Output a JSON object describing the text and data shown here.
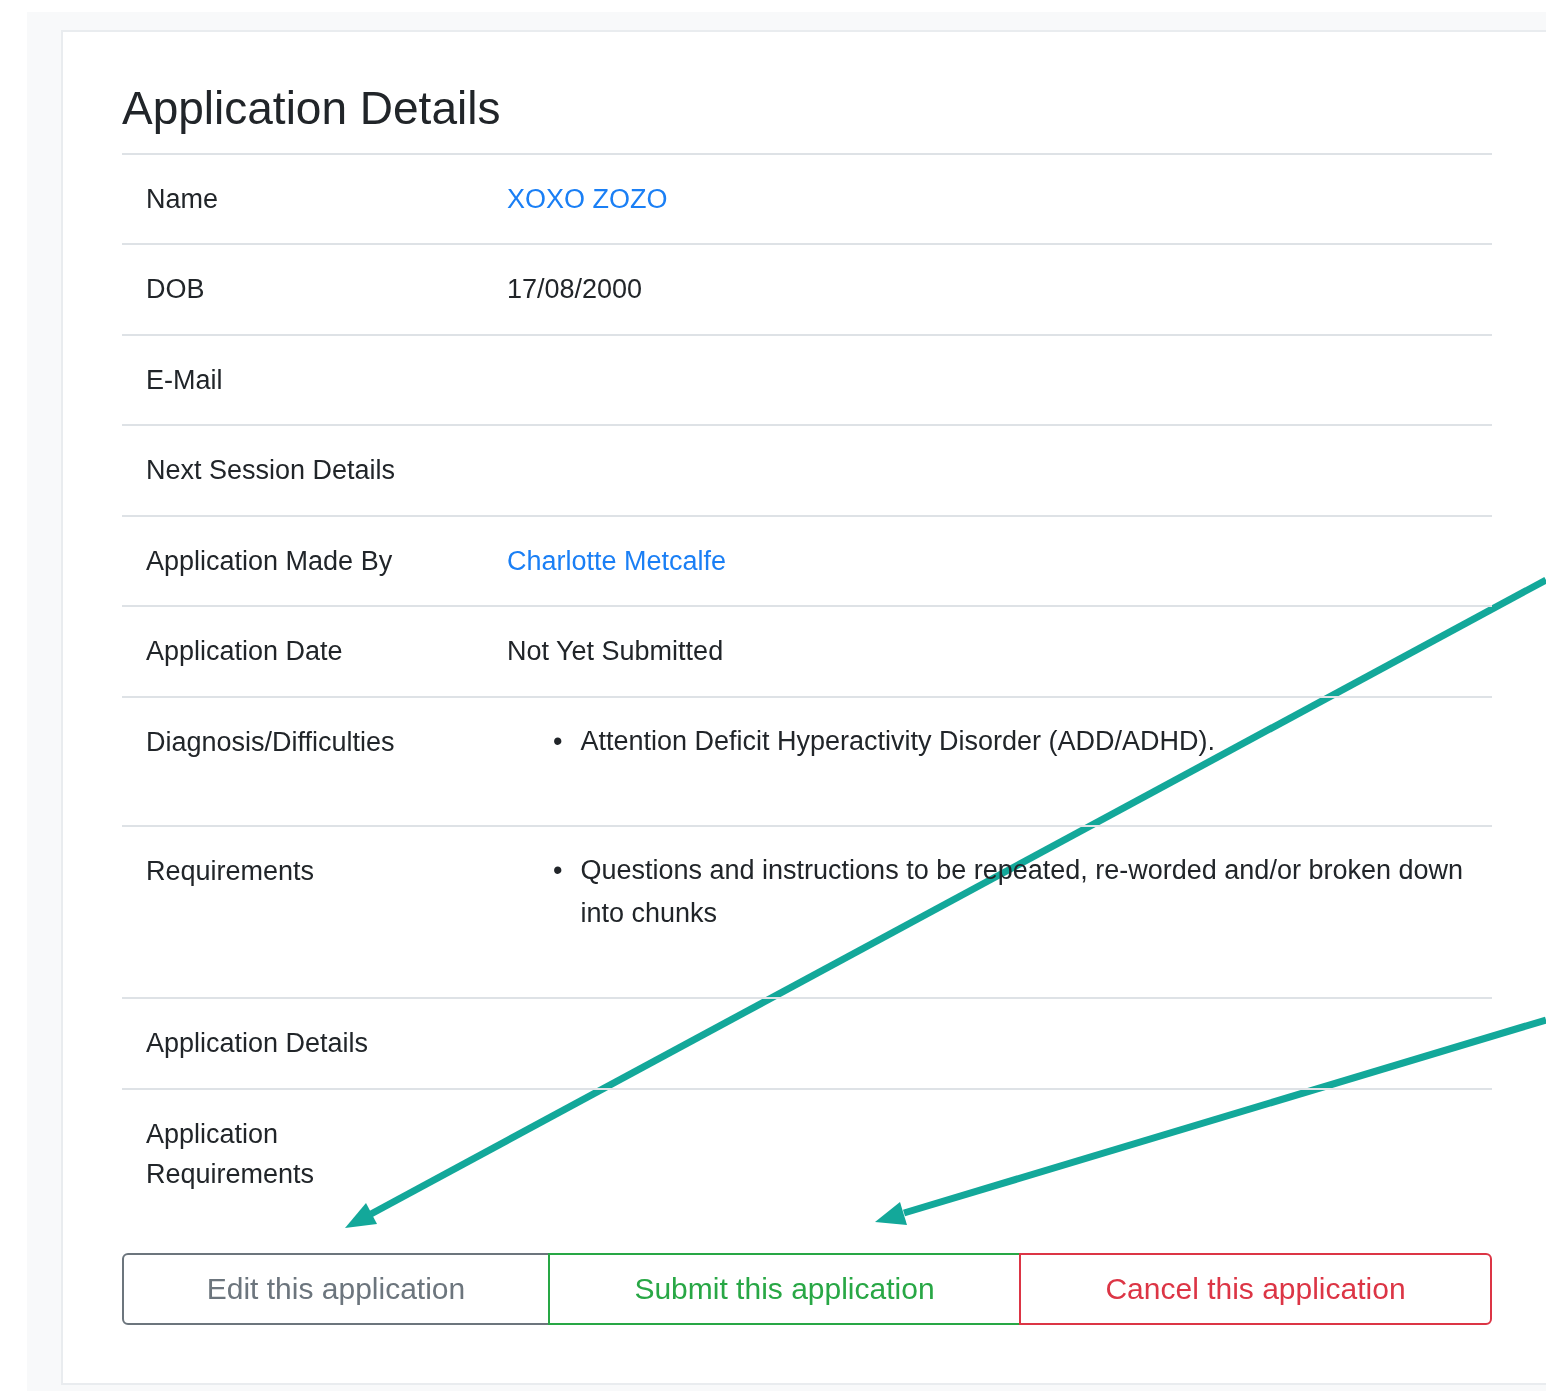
{
  "title": "Application Details",
  "rows": [
    {
      "label": "Name",
      "kind": "link",
      "value": "XOXO ZOZO"
    },
    {
      "label": "DOB",
      "kind": "text",
      "value": "17/08/2000"
    },
    {
      "label": "E-Mail",
      "kind": "empty"
    },
    {
      "label": "Next Session Details",
      "kind": "empty"
    },
    {
      "label": "Application Made By",
      "kind": "link",
      "value": "Charlotte Metcalfe"
    },
    {
      "label": "Application Date",
      "kind": "text",
      "value": "Not Yet Submitted"
    },
    {
      "label": "Diagnosis/Difficulties",
      "kind": "list",
      "marker": "•",
      "items": [
        "Attention Deficit Hyperactivity Disorder (ADD/ADHD)."
      ]
    },
    {
      "label": "Requirements",
      "kind": "list",
      "marker": "•",
      "items": [
        "Questions and instructions to be repeated, re-worded and/or broken down into chunks"
      ]
    },
    {
      "label": "Application Details",
      "kind": "empty"
    },
    {
      "label": "Application Requirements",
      "kind": "empty"
    }
  ],
  "buttons": [
    {
      "label": "Edit this application",
      "kind": "secondary"
    },
    {
      "label": "Submit this application",
      "kind": "success"
    },
    {
      "label": "Cancel this application",
      "kind": "danger"
    }
  ]
}
